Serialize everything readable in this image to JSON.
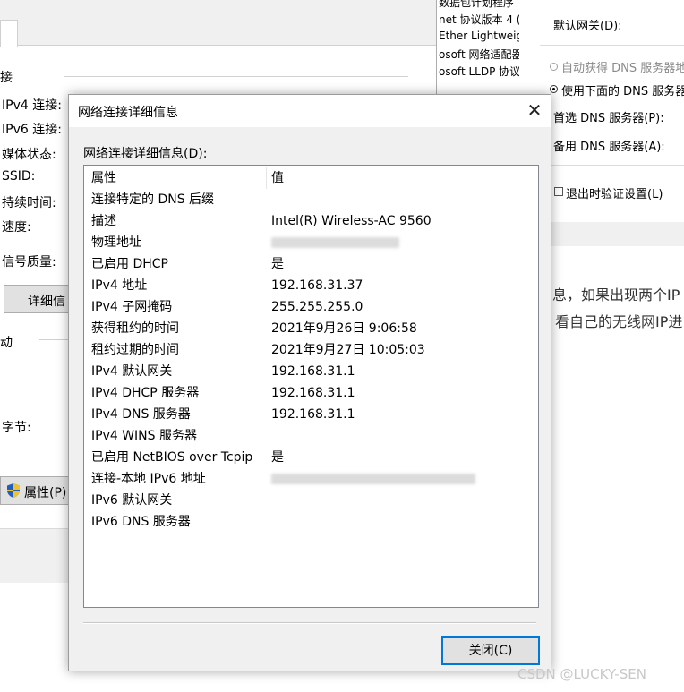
{
  "left_window": {
    "section1_label": "接",
    "rows": [
      {
        "label": "IPv4 连接:"
      },
      {
        "label": "IPv6 连接:"
      },
      {
        "label": "媒体状态:"
      },
      {
        "label": "SSID:"
      },
      {
        "label": "持续时间:"
      },
      {
        "label": "速度:"
      },
      {
        "label": "信号质量:"
      }
    ],
    "details_button": "详细信",
    "section2_label": "动",
    "bytes_label": "字节:",
    "properties_button": "属性(P)"
  },
  "middle_window": {
    "items": [
      "数据包计划程序",
      "net 协议版本 4 (",
      "Ether Lightweig",
      "osoft 网络适配器",
      "osoft LLDP 协议"
    ]
  },
  "right_window": {
    "default_gateway": "默认网关(D):",
    "auto_dns": "自动获得 DNS 服务器地址",
    "use_dns": "使用下面的 DNS 服务器地",
    "preferred_dns": "首选 DNS 服务器(P):",
    "alternate_dns": "备用 DNS 服务器(A):",
    "validate_on_exit": "退出时验证设置(L)"
  },
  "blog_text": {
    "line1": "息，如果出现两个IP",
    "line2": "看自己的无线网IP进"
  },
  "dialog": {
    "title": "网络连接详细信息",
    "list_label": "网络连接详细信息(D):",
    "columns": {
      "property": "属性",
      "value": "值"
    },
    "rows": [
      {
        "property": "连接特定的 DNS 后缀",
        "value": ""
      },
      {
        "property": "描述",
        "value": "Intel(R) Wireless-AC 9560"
      },
      {
        "property": "物理地址",
        "value": ""
      },
      {
        "property": "已启用 DHCP",
        "value": "是"
      },
      {
        "property": "IPv4 地址",
        "value": "192.168.31.37"
      },
      {
        "property": "IPv4 子网掩码",
        "value": "255.255.255.0"
      },
      {
        "property": "获得租约的时间",
        "value": "2021年9月26日 9:06:58"
      },
      {
        "property": "租约过期的时间",
        "value": "2021年9月27日 10:05:03"
      },
      {
        "property": "IPv4 默认网关",
        "value": "192.168.31.1"
      },
      {
        "property": "IPv4 DHCP 服务器",
        "value": "192.168.31.1"
      },
      {
        "property": "IPv4 DNS 服务器",
        "value": "192.168.31.1"
      },
      {
        "property": "IPv4 WINS 服务器",
        "value": ""
      },
      {
        "property": "已启用 NetBIOS over Tcpip",
        "value": "是"
      },
      {
        "property": "连接-本地 IPv6 地址",
        "value": ""
      },
      {
        "property": "IPv6 默认网关",
        "value": ""
      },
      {
        "property": "IPv6 DNS 服务器",
        "value": ""
      }
    ],
    "close_button": "关闭(C)",
    "close_icon": "close-icon"
  },
  "watermark": "CSDN @LUCKY-SEN"
}
